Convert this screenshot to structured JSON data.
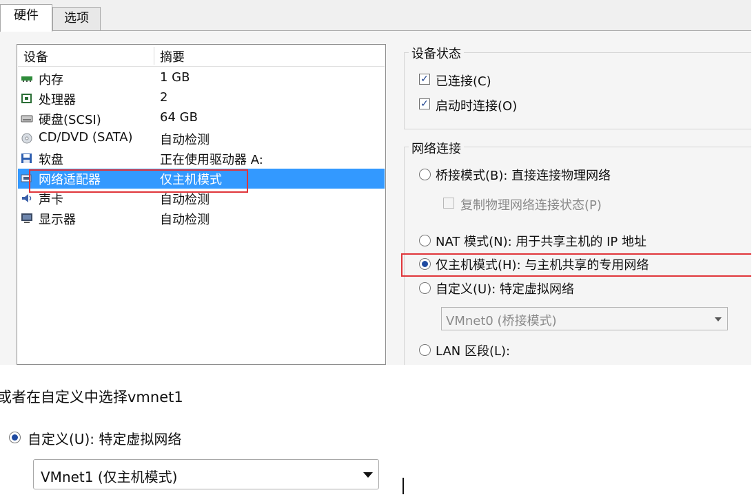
{
  "tabs": [
    {
      "label": "硬件"
    },
    {
      "label": "选项"
    }
  ],
  "device_list": {
    "columns": [
      "设备",
      "摘要"
    ],
    "rows": [
      {
        "name": "内存",
        "summary": "1 GB",
        "icon": "memory-icon"
      },
      {
        "name": "处理器",
        "summary": "2",
        "icon": "processor-icon"
      },
      {
        "name": "硬盘(SCSI)",
        "summary": "64 GB",
        "icon": "harddisk-icon"
      },
      {
        "name": "CD/DVD (SATA)",
        "summary": "自动检测",
        "icon": "cd-dvd-icon"
      },
      {
        "name": "软盘",
        "summary": "正在使用驱动器 A:",
        "icon": "floppy-icon"
      },
      {
        "name": "网络适配器",
        "summary": "仅主机模式",
        "icon": "network-adapter-icon",
        "selected": true
      },
      {
        "name": "声卡",
        "summary": "自动检测",
        "icon": "sound-card-icon"
      },
      {
        "name": "显示器",
        "summary": "自动检测",
        "icon": "display-icon"
      }
    ]
  },
  "device_status": {
    "title": "设备状态",
    "connected": {
      "label": "已连接(C)",
      "checked": true
    },
    "connect_on_start": {
      "label": "启动时连接(O)",
      "checked": true
    }
  },
  "network": {
    "title": "网络连接",
    "bridged": {
      "label": "桥接模式(B): 直接连接物理网络",
      "checked": false
    },
    "replicate": {
      "label": "复制物理网络连接状态(P)",
      "checked": false,
      "disabled": true
    },
    "nat": {
      "label": "NAT 模式(N): 用于共享主机的 IP 地址",
      "checked": false
    },
    "host_only": {
      "label": "仅主机模式(H): 与主机共享的专用网络",
      "checked": true
    },
    "custom": {
      "label": "自定义(U): 特定虚拟网络",
      "checked": false
    },
    "custom_select": {
      "value": "VMnet0 (桥接模式)",
      "disabled": true
    },
    "lan": {
      "label": "LAN 区段(L):",
      "checked": false
    }
  },
  "caption": "或者在自定义中选择vmnet1",
  "example": {
    "custom": {
      "label": "自定义(U): 特定虚拟网络",
      "checked": true
    },
    "select": {
      "value": "VMnet1 (仅主机模式)"
    }
  },
  "colors": {
    "selection": "#3399ff",
    "highlight_box": "#e0353a",
    "radio_dot": "#1f4aa0"
  }
}
